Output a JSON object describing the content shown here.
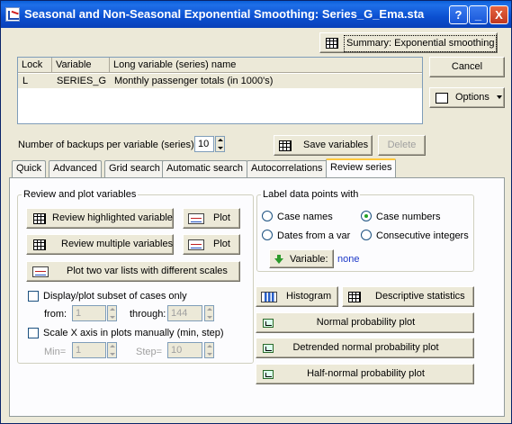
{
  "window": {
    "title": "Seasonal and Non-Seasonal Exponential Smoothing: Series_G_Ema.sta",
    "controls": {
      "help": "?",
      "minimize": "_",
      "close": "X"
    }
  },
  "top_buttons": {
    "summary": "Summary:  Exponential smoothing",
    "cancel": "Cancel",
    "options": "Options"
  },
  "variable_list": {
    "headers": [
      "Lock",
      "Variable",
      "Long variable (series) name"
    ],
    "rows": [
      {
        "lock": "L",
        "variable": "SERIES_G",
        "long_name": "Monthly passenger totals (in 1000's)"
      }
    ]
  },
  "backups": {
    "label": "Number of backups per variable (series):",
    "value": "10",
    "save_button": "Save variables",
    "delete_button": "Delete"
  },
  "tabs": [
    "Quick",
    "Advanced",
    "Grid search",
    "Automatic search",
    "Autocorrelations",
    "Review series"
  ],
  "active_tab": "Review series",
  "review": {
    "group_title": "Review and plot variables",
    "review_highlighted": "Review highlighted variable",
    "plot1": "Plot",
    "review_multiple": "Review multiple variables",
    "plot2": "Plot",
    "plot_two_lists": "Plot two var lists with different scales",
    "subset_label": "Display/plot subset of cases only",
    "from_label": "from:",
    "from_value": "1",
    "through_label": "through:",
    "through_value": "144",
    "scale_label": "Scale X axis in plots manually (min, step)",
    "min_label": "Min=",
    "min_value": "1",
    "step_label": "Step=",
    "step_value": "10"
  },
  "label_points": {
    "group_title": "Label data points with",
    "case_names": "Case names",
    "case_numbers": "Case numbers",
    "dates_from_var": "Dates from a var",
    "consecutive_integers": "Consecutive integers",
    "variable_button": "Variable:",
    "variable_value": "none",
    "selected": "Case numbers"
  },
  "plots": {
    "histogram": "Histogram",
    "descriptive": "Descriptive statistics",
    "normal": "Normal probability plot",
    "detrended": "Detrended normal probability plot",
    "half_normal": "Half-normal probability plot"
  }
}
